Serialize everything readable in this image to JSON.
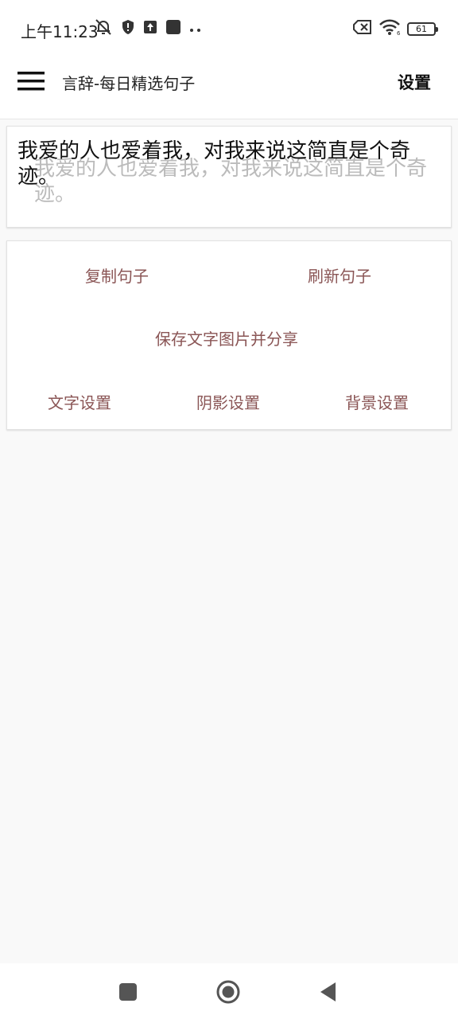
{
  "status_bar": {
    "time": "上午11:23",
    "battery_level": "61",
    "icons_left": [
      "muted-bell-icon",
      "shield-icon",
      "upload-icon",
      "square-app-icon",
      "more-dots-icon"
    ],
    "icons_right": [
      "sim-error-icon",
      "wifi-icon",
      "battery-icon"
    ]
  },
  "app_bar": {
    "title": "言辞-每日精选句子",
    "settings_label": "设置",
    "menu_icon": "hamburger-menu-icon"
  },
  "quote": {
    "text": "我爱的人也爱着我，对我来说这简直是个奇迹。",
    "text_color": "#111111",
    "shadow_color": "#bbbbbb"
  },
  "actions": {
    "copy_label": "复制句子",
    "refresh_label": "刷新句子",
    "save_share_label": "保存文字图片并分享",
    "font_settings_label": "文字设置",
    "shadow_settings_label": "阴影设置",
    "background_settings_label": "背景设置",
    "accent_color": "#8a5555"
  },
  "nav_bar": {
    "icons": [
      "recents-square-icon",
      "home-circle-icon",
      "back-triangle-icon"
    ]
  }
}
